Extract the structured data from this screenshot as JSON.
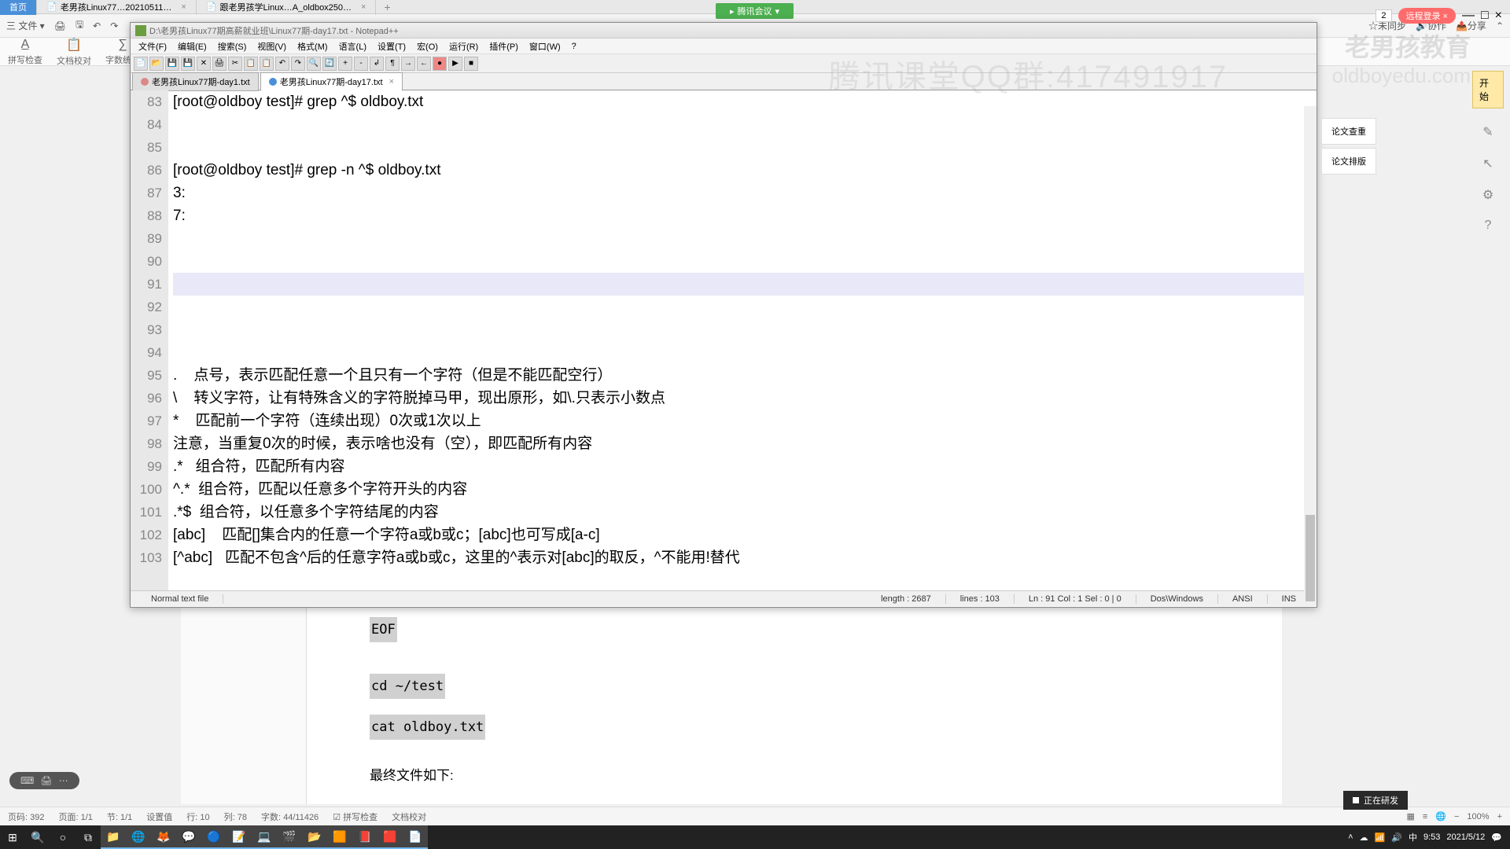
{
  "browser": {
    "tabs": [
      {
        "label": "首页"
      },
      {
        "label": "老男孩Linux77…20210511…"
      },
      {
        "label": "跟老男孩学Linux…A_oldbox250…"
      }
    ]
  },
  "tencent_live": "腾讯会议",
  "top_badge": "2",
  "login": "远程登录",
  "word_menu": {
    "file": "三 文件 ▾",
    "items": [
      "🖨",
      "🖫",
      "↶",
      "↷"
    ]
  },
  "word_right": [
    "☆未同步",
    "🔊协作",
    "📤分享",
    "⌃"
  ],
  "format": {
    "items": [
      "拼写检查",
      "文档校对",
      "字数统计"
    ]
  },
  "npp": {
    "title": "D:\\老男孩Linux77期高薪就业班\\Linux77期-day17.txt - Notepad++",
    "menu": [
      "文件(F)",
      "编辑(E)",
      "搜索(S)",
      "视图(V)",
      "格式(M)",
      "语言(L)",
      "设置(T)",
      "宏(O)",
      "运行(R)",
      "插件(P)",
      "窗口(W)",
      "?"
    ],
    "tabs": [
      {
        "label": "老男孩Linux77期-day1.txt"
      },
      {
        "label": "老男孩Linux77期-day17.txt"
      }
    ],
    "lines": [
      {
        "n": 83,
        "t": "[root@oldboy test]# grep ^$ oldboy.txt"
      },
      {
        "n": 84,
        "t": ""
      },
      {
        "n": 85,
        "t": ""
      },
      {
        "n": 86,
        "t": "[root@oldboy test]# grep -n ^$ oldboy.txt"
      },
      {
        "n": 87,
        "t": "3:"
      },
      {
        "n": 88,
        "t": "7:"
      },
      {
        "n": 89,
        "t": ""
      },
      {
        "n": 90,
        "t": ""
      },
      {
        "n": 91,
        "t": "",
        "hl": true
      },
      {
        "n": 92,
        "t": ""
      },
      {
        "n": 93,
        "t": ""
      },
      {
        "n": 94,
        "t": ""
      },
      {
        "n": 95,
        "t": ".    点号，表示匹配任意一个且只有一个字符（但是不能匹配空行）"
      },
      {
        "n": 96,
        "t": "\\    转义字符，让有特殊含义的字符脱掉马甲，现出原形，如\\.只表示小数点"
      },
      {
        "n": 97,
        "t": "*    匹配前一个字符（连续出现）0次或1次以上"
      },
      {
        "n": 98,
        "t": "注意，当重复0次的时候，表示啥也没有（空），即匹配所有内容"
      },
      {
        "n": 99,
        "t": ".*   组合符，匹配所有内容"
      },
      {
        "n": 100,
        "t": "^.*  组合符，匹配以任意多个字符开头的内容"
      },
      {
        "n": 101,
        "t": ".*$  组合符，以任意多个字符结尾的内容"
      },
      {
        "n": 102,
        "t": "[abc]    匹配[]集合内的任意一个字符a或b或c；[abc]也可写成[a-c]"
      },
      {
        "n": 103,
        "t": "[^abc]   匹配不包含^后的任意字符a或b或c，这里的^表示对[abc]的取反，^不能用!替代"
      }
    ],
    "status": {
      "filetype": "Normal text file",
      "length": "length : 2687",
      "lines": "lines : 103",
      "pos": "Ln : 91   Col : 1   Sel : 0 | 0",
      "eol": "Dos\\Windows",
      "enc": "ANSI",
      "mode": "INS"
    }
  },
  "watermark": {
    "brand": "老男孩教育",
    "url": "oldboyedu.com",
    "qq": "腾讯课堂QQ群:417491917"
  },
  "right_panel": [
    "论文查重",
    "论文排版"
  ],
  "far_right": {
    "start": "开始"
  },
  "bg_doc": {
    "eof": "EOF",
    "cd": "cd ~/test",
    "cat": "cat oldboy.txt",
    "final": "最终文件如下:"
  },
  "word_status": {
    "left": [
      "页码: 392",
      "页面: 1/1",
      "节: 1/1",
      "设置值",
      "行: 10",
      "列: 78",
      "字数: 44/11426",
      "☑ 拼写检查",
      "文档校对"
    ],
    "zoom": "100%"
  },
  "tray": {
    "time": "9:53",
    "date": "2021/5/12"
  },
  "rec": "正在研发"
}
